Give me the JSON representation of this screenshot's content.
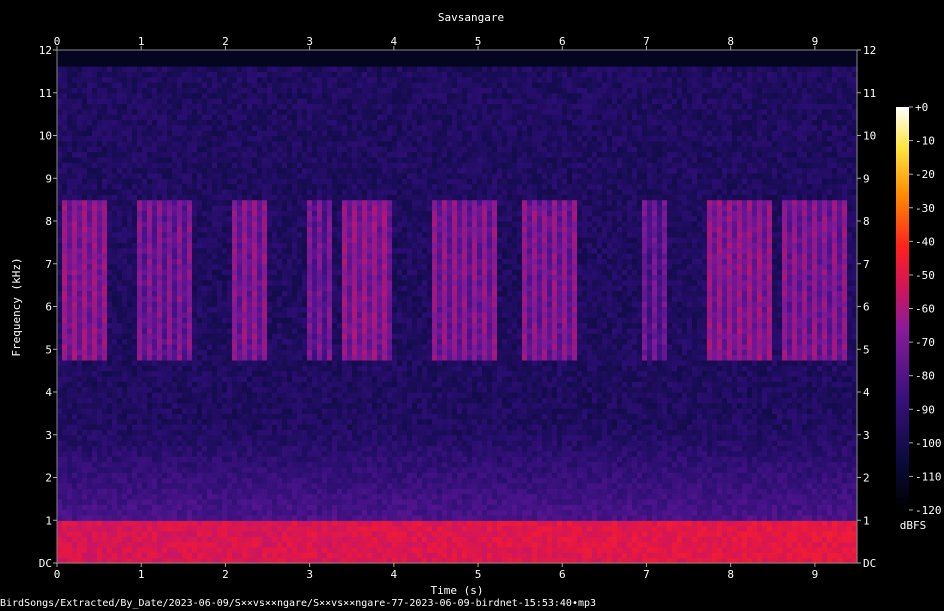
{
  "chart_data": {
    "type": "heatmap",
    "title": "Savsangare",
    "xlabel": "Time (s)",
    "ylabel": "Frequency (kHz)",
    "xlim": [
      0,
      9.5
    ],
    "ylim": [
      0,
      12
    ],
    "x_ticks": [
      "0",
      "1",
      "2",
      "3",
      "4",
      "5",
      "6",
      "7",
      "8",
      "9"
    ],
    "y_ticks": [
      "DC",
      "1",
      "2",
      "3",
      "4",
      "5",
      "6",
      "7",
      "8",
      "9",
      "10",
      "11",
      "12"
    ],
    "colorbar": {
      "label": "dBFS",
      "range": [
        -120,
        0
      ],
      "ticks": [
        "+0",
        "-10",
        "-20",
        "-30",
        "-40",
        "-50",
        "-60",
        "-70",
        "-80",
        "-90",
        "-100",
        "-110",
        "-120"
      ]
    },
    "background_level_dbfs": -98,
    "low_frequency_noise": {
      "freq_khz_max": 1.0,
      "level_dbfs": -60
    },
    "call_band_khz": [
      4.8,
      8.5
    ],
    "call_bursts": [
      {
        "t_start": 0.05,
        "t_end": 0.6,
        "level_dbfs": -70
      },
      {
        "t_start": 0.95,
        "t_end": 1.6,
        "level_dbfs": -74
      },
      {
        "t_start": 2.05,
        "t_end": 2.5,
        "level_dbfs": -72
      },
      {
        "t_start": 2.95,
        "t_end": 3.25,
        "level_dbfs": -76
      },
      {
        "t_start": 3.4,
        "t_end": 4.0,
        "level_dbfs": -70
      },
      {
        "t_start": 4.45,
        "t_end": 5.2,
        "level_dbfs": -72
      },
      {
        "t_start": 5.5,
        "t_end": 6.2,
        "level_dbfs": -72
      },
      {
        "t_start": 6.95,
        "t_end": 7.25,
        "level_dbfs": -78
      },
      {
        "t_start": 7.7,
        "t_end": 8.5,
        "level_dbfs": -70
      },
      {
        "t_start": 8.6,
        "t_end": 9.4,
        "level_dbfs": -72
      }
    ]
  },
  "footer": {
    "path": "BirdSongs/Extracted/By_Date/2023-06-09/S××vs××ngare/S××vs××ngare-77-2023-06-09-birdnet-15:53:40•mp3"
  }
}
